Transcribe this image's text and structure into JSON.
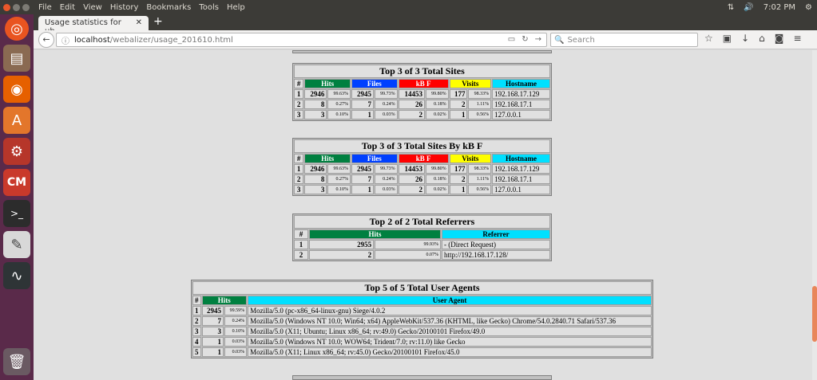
{
  "system_menu": [
    "File",
    "Edit",
    "View",
    "History",
    "Bookmarks",
    "Tools",
    "Help"
  ],
  "tray": {
    "time": "7:02 PM"
  },
  "browser": {
    "tab_title": "Usage statistics for ub...",
    "url_host": "localhost",
    "url_path": "/webalizer/usage_201610.html",
    "search_placeholder": "Search"
  },
  "colors": {
    "hits": "#008040",
    "files": "#0040ff",
    "kb": "#ff0000",
    "visits": "#ffff00",
    "host": "#00e0ff"
  },
  "sites": {
    "title": "Top 3 of 3 Total Sites",
    "headers": [
      "#",
      "Hits",
      "Files",
      "kB F",
      "Visits",
      "Hostname"
    ],
    "rows": [
      [
        "1",
        "2946",
        "99.63%",
        "2945",
        "99.73%",
        "14453",
        "99.80%",
        "177",
        "98.33%",
        "192.168.17.129"
      ],
      [
        "2",
        "8",
        "0.27%",
        "7",
        "0.24%",
        "26",
        "0.18%",
        "2",
        "1.11%",
        "192.168.17.1"
      ],
      [
        "3",
        "3",
        "0.10%",
        "1",
        "0.03%",
        "2",
        "0.02%",
        "1",
        "0.56%",
        "127.0.0.1"
      ]
    ]
  },
  "sites_kb": {
    "title": "Top 3 of 3 Total Sites By kB F",
    "headers": [
      "#",
      "Hits",
      "Files",
      "kB F",
      "Visits",
      "Hostname"
    ],
    "rows": [
      [
        "1",
        "2946",
        "99.63%",
        "2945",
        "99.73%",
        "14453",
        "99.80%",
        "177",
        "98.33%",
        "192.168.17.129"
      ],
      [
        "2",
        "8",
        "0.27%",
        "7",
        "0.24%",
        "26",
        "0.18%",
        "2",
        "1.11%",
        "192.168.17.1"
      ],
      [
        "3",
        "3",
        "0.10%",
        "1",
        "0.03%",
        "2",
        "0.02%",
        "1",
        "0.56%",
        "127.0.0.1"
      ]
    ]
  },
  "referrers": {
    "title": "Top 2 of 2 Total Referrers",
    "headers": [
      "#",
      "Hits",
      "Referrer"
    ],
    "rows": [
      [
        "1",
        "2955",
        "99.93%",
        "- (Direct Request)"
      ],
      [
        "2",
        "2",
        "0.07%",
        "http://192.168.17.128/"
      ]
    ]
  },
  "agents": {
    "title": "Top 5 of 5 Total User Agents",
    "headers": [
      "#",
      "Hits",
      "User Agent"
    ],
    "rows": [
      [
        "1",
        "2945",
        "99.59%",
        "Mozilla/5.0 (pc-x86_64-linux-gnu) Siege/4.0.2"
      ],
      [
        "2",
        "7",
        "0.24%",
        "Mozilla/5.0 (Windows NT 10.0; Win64; x64) AppleWebKit/537.36 (KHTML, like Gecko) Chrome/54.0.2840.71 Safari/537.36"
      ],
      [
        "3",
        "3",
        "0.10%",
        "Mozilla/5.0 (X11; Ubuntu; Linux x86_64; rv:49.0) Gecko/20100101 Firefox/49.0"
      ],
      [
        "4",
        "1",
        "0.03%",
        "Mozilla/5.0 (Windows NT 10.0; WOW64; Trident/7.0; rv:11.0) like Gecko"
      ],
      [
        "5",
        "1",
        "0.03%",
        "Mozilla/5.0 (X11; Linux x86_64; rv:45.0) Gecko/20100101 Firefox/45.0"
      ]
    ]
  }
}
